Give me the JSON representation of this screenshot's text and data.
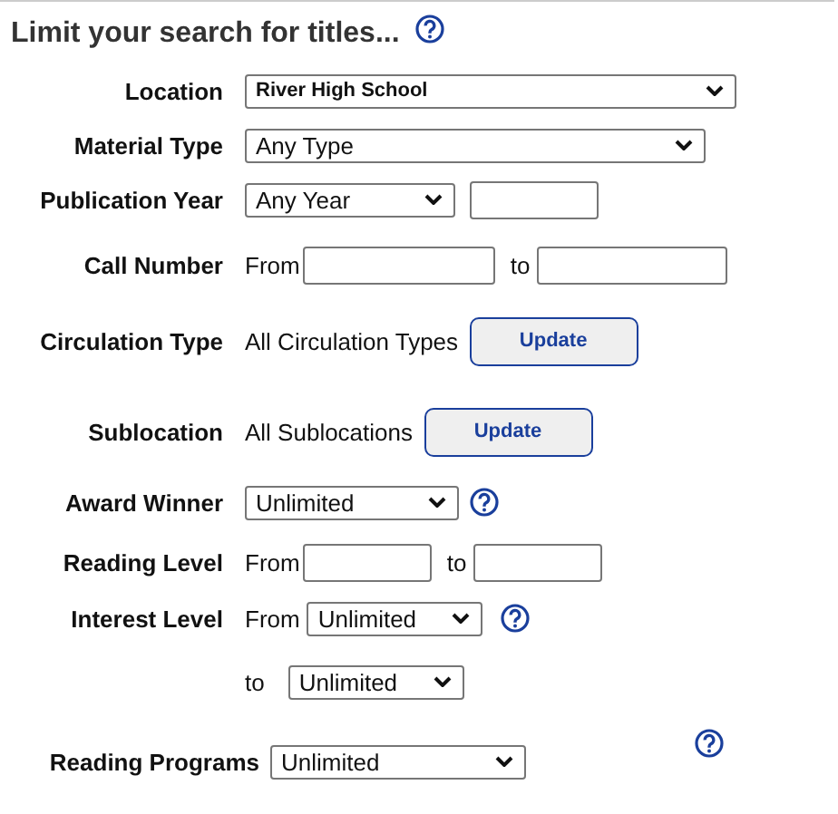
{
  "heading": {
    "text": "Limit your search for titles..."
  },
  "rows": [
    {
      "label": "Location",
      "parts": [
        {
          "kind": "select",
          "value": "River High School"
        }
      ]
    },
    {
      "label": "Material Type",
      "parts": [
        {
          "kind": "select",
          "value": "Any Type"
        }
      ]
    },
    {
      "label": "Publication Year",
      "parts": [
        {
          "kind": "select",
          "value": "Any Year"
        },
        {
          "kind": "input"
        }
      ]
    },
    {
      "label": "Call Number",
      "parts": [
        {
          "kind": "text",
          "text": "From"
        },
        {
          "kind": "input"
        },
        {
          "kind": "text",
          "text": "to"
        },
        {
          "kind": "input"
        }
      ]
    },
    {
      "label": "Circulation Type",
      "parts": [
        {
          "kind": "text",
          "text": "All Circulation Types"
        },
        {
          "kind": "button",
          "text": "Update"
        }
      ]
    },
    {
      "label": "Sublocation",
      "parts": [
        {
          "kind": "text",
          "text": "All Sublocations"
        },
        {
          "kind": "button",
          "text": "Update"
        }
      ]
    },
    {
      "label": "Award Winner",
      "parts": [
        {
          "kind": "select",
          "value": "Unlimited"
        },
        {
          "kind": "help"
        }
      ]
    },
    {
      "label": "Reading Level",
      "parts": [
        {
          "kind": "text",
          "text": "From"
        },
        {
          "kind": "input"
        },
        {
          "kind": "text",
          "text": "to"
        },
        {
          "kind": "input"
        }
      ]
    },
    {
      "label": "Interest Level",
      "parts": [
        {
          "kind": "text",
          "text": "From"
        },
        {
          "kind": "select",
          "value": "Unlimited"
        },
        {
          "kind": "help"
        }
      ]
    },
    {
      "parts": [
        {
          "kind": "text",
          "text": "to"
        },
        {
          "kind": "select",
          "value": "Unlimited"
        }
      ]
    },
    {
      "label": "Reading Programs",
      "parts": [
        {
          "kind": "select",
          "value": "Unlimited"
        },
        {
          "kind": "help"
        }
      ]
    }
  ]
}
